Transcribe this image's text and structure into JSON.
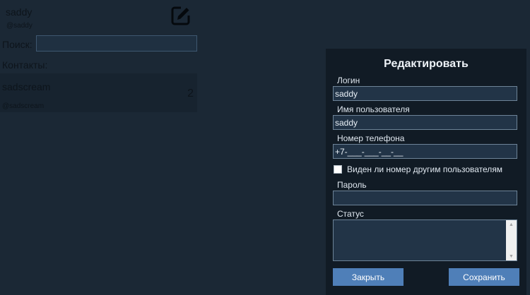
{
  "profile": {
    "name": "saddy",
    "login": "@saddy"
  },
  "search": {
    "label": "Поиск:",
    "value": ""
  },
  "contacts": {
    "label": "Контакты:",
    "items": [
      {
        "name": "sadscream",
        "login": "@sadscream",
        "count": "2"
      }
    ]
  },
  "icons": {
    "edit": "edit-square-pencil-icon"
  },
  "modal": {
    "title": "Редактировать",
    "login_label": "Логин",
    "login_value": "saddy",
    "username_label": "Имя пользователя",
    "username_value": "saddy",
    "phone_label": "Номер телефона",
    "phone_value": "+7-___-___-__-__",
    "phone_visible_label": "Виден ли номер другим пользователям",
    "phone_visible_checked": false,
    "password_label": "Пароль",
    "password_value": "",
    "status_label": "Статус",
    "status_value": "",
    "close_label": "Закрыть",
    "save_label": "Сохранить"
  },
  "colors": {
    "background": "#1b2835",
    "modal_background": "#111b25",
    "input_background": "#223447",
    "button": "#4f7fb8"
  }
}
